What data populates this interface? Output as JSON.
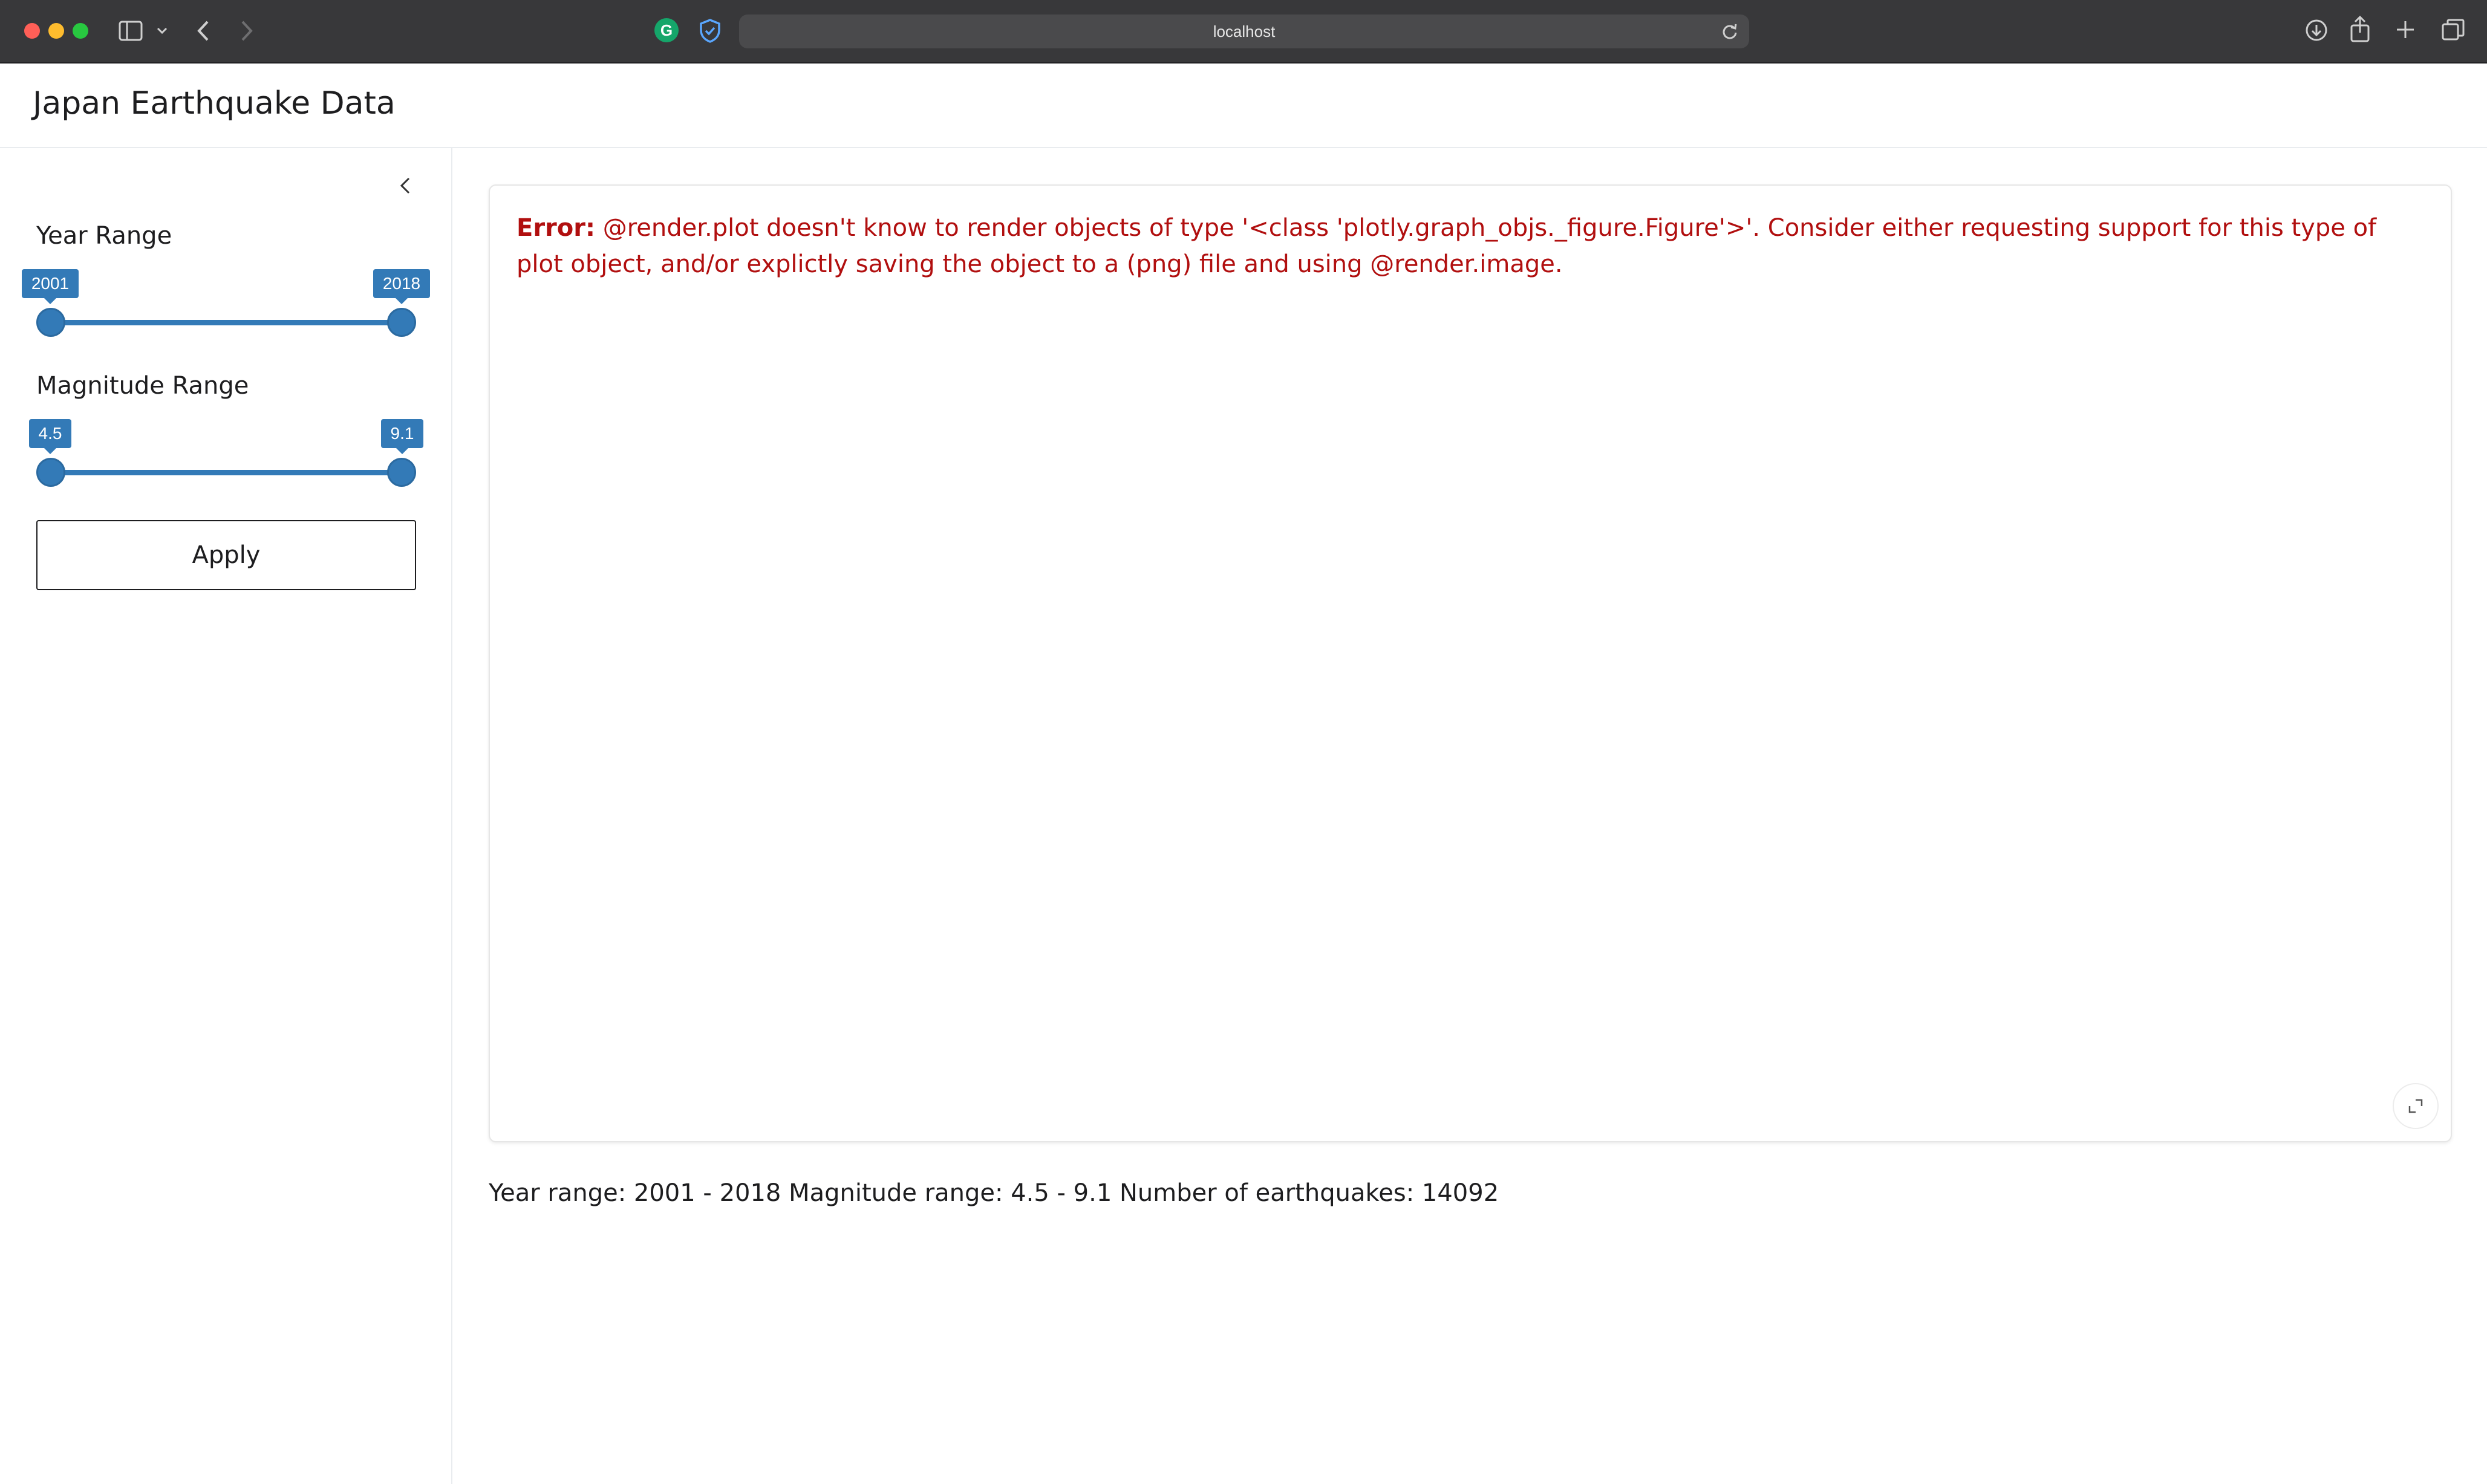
{
  "browser": {
    "url": "localhost",
    "extension_icon_letter": "G",
    "icons": [
      "sidebar-icon",
      "chevron-down-icon",
      "back-icon",
      "forward-icon",
      "shield-icon",
      "reload-icon",
      "download-icon",
      "share-icon",
      "new-tab-icon",
      "tabs-overview-icon"
    ]
  },
  "app": {
    "title": "Japan Earthquake Data"
  },
  "sidebar": {
    "year_range": {
      "label": "Year Range",
      "min_value": "2001",
      "max_value": "2018"
    },
    "magnitude_range": {
      "label": "Magnitude Range",
      "min_value": "4.5",
      "max_value": "9.1"
    },
    "apply_label": "Apply"
  },
  "main": {
    "error_prefix": "Error:",
    "error_message": "@render.plot doesn't know to render objects of type '<class 'plotly.graph_objs._figure.Figure'>'. Consider either requesting support for this type of plot object, and/or  explictly saving the object to a (png) file and using @render.image.",
    "summary": "Year range: 2001 - 2018 Magnitude range: 4.5 - 9.1 Number of earthquakes: 14092"
  },
  "colors": {
    "accent": "#337ab7",
    "error": "#b10f0f",
    "chrome": "#38383a"
  }
}
